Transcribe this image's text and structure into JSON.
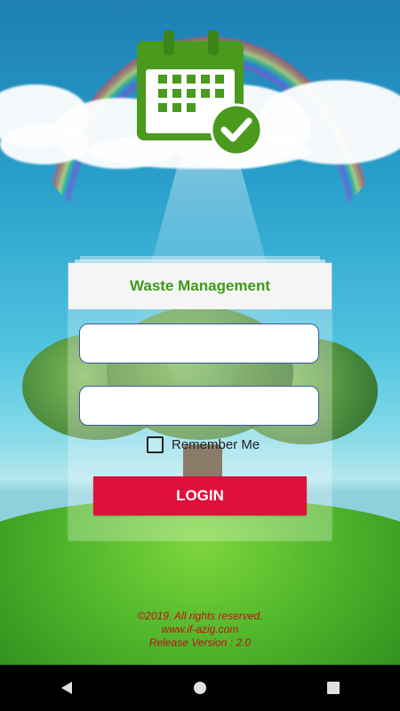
{
  "app": {
    "title": "Waste Management",
    "icon": "calendar-check-icon"
  },
  "login_form": {
    "username_value": "",
    "password_value": "",
    "remember_me_label": "Remember Me",
    "remember_me_checked": false,
    "login_button_label": "LOGIN"
  },
  "footer": {
    "copyright": "©2019. All rights reserved.",
    "website": "www.if-azig.com",
    "release": "Release Version : 2.0"
  },
  "navbar": {
    "back": "back-icon",
    "home": "home-icon",
    "recents": "recents-icon"
  },
  "colors": {
    "accent_green": "#3f9a1a",
    "login_red": "#e0103a",
    "footer_red": "#c0101a"
  }
}
